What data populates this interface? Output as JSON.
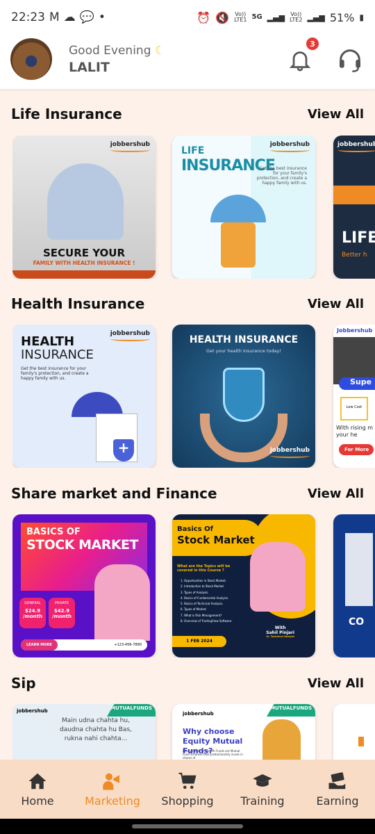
{
  "status_bar": {
    "time": "22:23",
    "battery": "51%",
    "sim1": "LTE1",
    "sim2": "LTE2",
    "network": "5G",
    "volte": "Vo))"
  },
  "header": {
    "greeting": "Good Evening",
    "user_name": "LALIT",
    "notification_count": "3"
  },
  "sections": [
    {
      "title": "Life Insurance",
      "view_all": "View All",
      "cards": [
        {
          "line1": "SECURE YOUR",
          "line2": "FAMILY WITH HEALTH INSURANCE !",
          "logo": "jobbershub"
        },
        {
          "line1": "LIFE",
          "line2": "INSURANCE",
          "body": "Get the best insurance for your family's protection, and create a happy family with us.",
          "logo": "jobbershub"
        },
        {
          "line1": "LIFE",
          "line2": "Better h",
          "logo": "jobbershub"
        }
      ]
    },
    {
      "title": "Health Insurance",
      "view_all": "View All",
      "cards": [
        {
          "line1": "HEALTH",
          "line2": "INSURANCE",
          "body": "Get the best insurance for your family's protection, and create a happy family with us.",
          "logo": "jobbershub"
        },
        {
          "line1": "HEALTH INSURANCE",
          "line2": "Get your health insurance today!",
          "logo": "jobbershub"
        },
        {
          "line1": "Jobbershub",
          "line2": "Supe",
          "line3": "Low Cost",
          "line4": "For More",
          "body": "With rising m your he"
        }
      ]
    },
    {
      "title": "Share market and Finance",
      "view_all": "View All",
      "cards": [
        {
          "line1": "BASICS OF",
          "line2": "STOCK MARKET",
          "plan1": "GENERAL",
          "price1": "$24.9 /month",
          "plan2": "PRIVATE",
          "price2": "$42.9 /month",
          "cta": "LEARN MORE",
          "phone": "+123-456-7890"
        },
        {
          "line1": "Basics Of",
          "line2": "Stock Market",
          "subtitle": "What are the Topics will be covered in this Course ?",
          "topics": [
            "1. Opportunities in Stock Market.",
            "2. Introduction to Stock Market.",
            "3. Types of Analysis.",
            "4. Basics of Fundamental Analysis.",
            "5. Basics of Technical Analysis.",
            "6. Types of Market.",
            "7. What is Risk Management?",
            "8. Overview of TradingView Software."
          ],
          "date": "1 FEB 2024",
          "with": "With",
          "presenter": "Sahil Pinjari",
          "role": "Sr. Technical Analyst"
        },
        {
          "line1": "CO"
        }
      ]
    },
    {
      "title": "Sip",
      "view_all": "View All",
      "cards": [
        {
          "tag": "MUTUALFUNDS",
          "logo": "jobbershub",
          "text": "Main udna chahta hu, daudna chahta hu Bas, rukna nahi chahta..."
        },
        {
          "tag": "MUTUALFUNDS",
          "logo": "jobbershub",
          "line1": "Why choose Equity Mutual Funds?",
          "body": "Equity Funds or Growth Funds are Mutual Fund schemes that predominantly invest in shares of"
        },
        {}
      ]
    }
  ],
  "bottom_nav": [
    {
      "label": "Home"
    },
    {
      "label": "Marketing",
      "active": true
    },
    {
      "label": "Shopping"
    },
    {
      "label": "Training"
    },
    {
      "label": "Earning"
    }
  ],
  "colors": {
    "accent": "#f08a24",
    "background": "#fdf1ea",
    "nav_bg": "#f8dcc6",
    "badge": "#e53935"
  }
}
